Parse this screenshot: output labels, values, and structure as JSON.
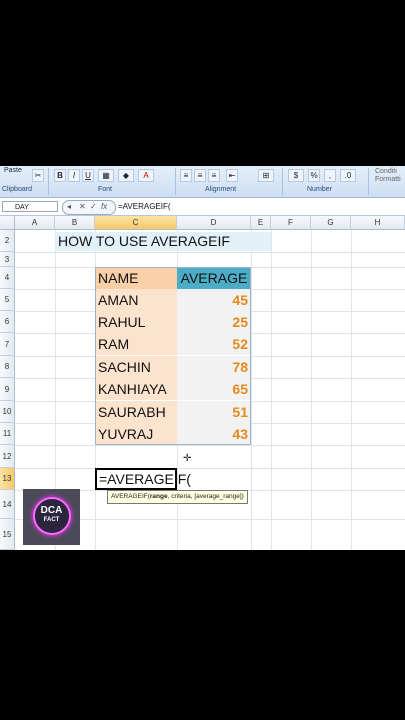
{
  "ribbon": {
    "clipboard_label": "Clipboard",
    "font_label": "Font",
    "alignment_label": "Alignment",
    "number_label": "Number",
    "paste_label": "Paste",
    "conditional_label": "Conditi",
    "formatting_label": "Formatti"
  },
  "formula_bar": {
    "name_box": "DAY",
    "formula": "=AVERAGEIF("
  },
  "columns": [
    "A",
    "B",
    "C",
    "D",
    "E",
    "F",
    "G",
    "H"
  ],
  "rows": [
    "2",
    "3",
    "4",
    "5",
    "6",
    "7",
    "8",
    "9",
    "10",
    "11",
    "12",
    "13",
    "14",
    "15"
  ],
  "sheet": {
    "title": "HOW TO USE AVERAGEIF",
    "table": {
      "headers": [
        "NAME",
        "AVERAGE"
      ],
      "rows": [
        {
          "name": "AMAN",
          "average": "45"
        },
        {
          "name": "RAHUL",
          "average": "25"
        },
        {
          "name": "RAM",
          "average": "52"
        },
        {
          "name": "SACHIN",
          "average": "78"
        },
        {
          "name": "KANHIAYA",
          "average": "65"
        },
        {
          "name": "SAURABH",
          "average": "51"
        },
        {
          "name": "YUVRAJ",
          "average": "43"
        }
      ]
    },
    "active_cell_text": "=AVERAGEIF(",
    "tooltip": {
      "fn": "AVERAGEIF(",
      "arg1": "range",
      "rest": ", criteria, [average_range])"
    }
  },
  "logo": {
    "line1": "DCA",
    "line2": "FACT"
  }
}
